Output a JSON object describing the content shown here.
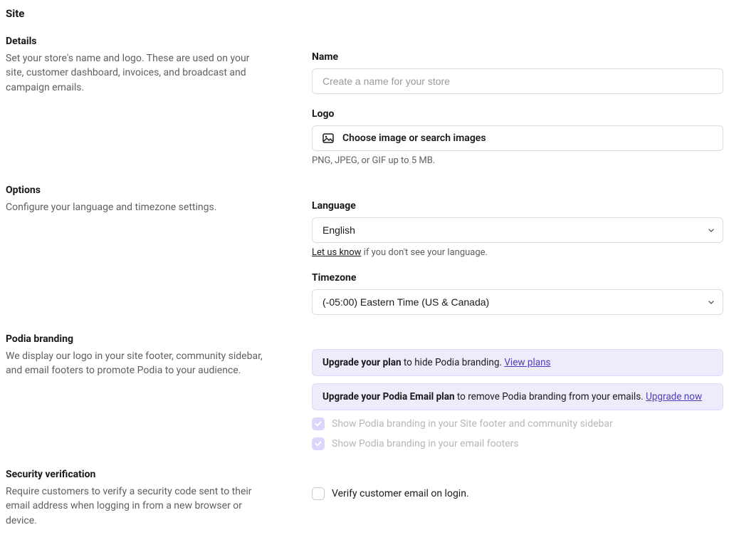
{
  "page_title": "Site",
  "details": {
    "heading": "Details",
    "desc": "Set your store's name and logo. These are used on your site, customer dashboard, invoices, and broadcast and campaign emails.",
    "name_label": "Name",
    "name_placeholder": "Create a name for your store",
    "logo_label": "Logo",
    "logo_picker_text": "Choose image or search images",
    "logo_helper": "PNG, JPEG, or GIF up to 5 MB."
  },
  "options": {
    "heading": "Options",
    "desc": "Configure your language and timezone settings.",
    "language_label": "Language",
    "language_value": "English",
    "language_helper_link": "Let us know",
    "language_helper_rest": " if you don't see your language.",
    "timezone_label": "Timezone",
    "timezone_value": "(-05:00) Eastern Time (US & Canada)"
  },
  "branding": {
    "heading": "Podia branding",
    "desc": "We display our logo in your site footer, community sidebar, and email footers to promote Podia to your audience.",
    "alert1_strong": "Upgrade your plan",
    "alert1_rest": " to hide Podia branding. ",
    "alert1_link": "View plans",
    "alert2_strong": "Upgrade your Podia Email plan",
    "alert2_rest": " to remove Podia branding from your emails. ",
    "alert2_link": "Upgrade now",
    "check1": "Show Podia branding in your Site footer and community sidebar",
    "check2": "Show Podia branding in your email footers"
  },
  "security": {
    "heading": "Security verification",
    "desc": "Require customers to verify a security code sent to their email address when logging in from a new browser or device.",
    "check": "Verify customer email on login."
  }
}
